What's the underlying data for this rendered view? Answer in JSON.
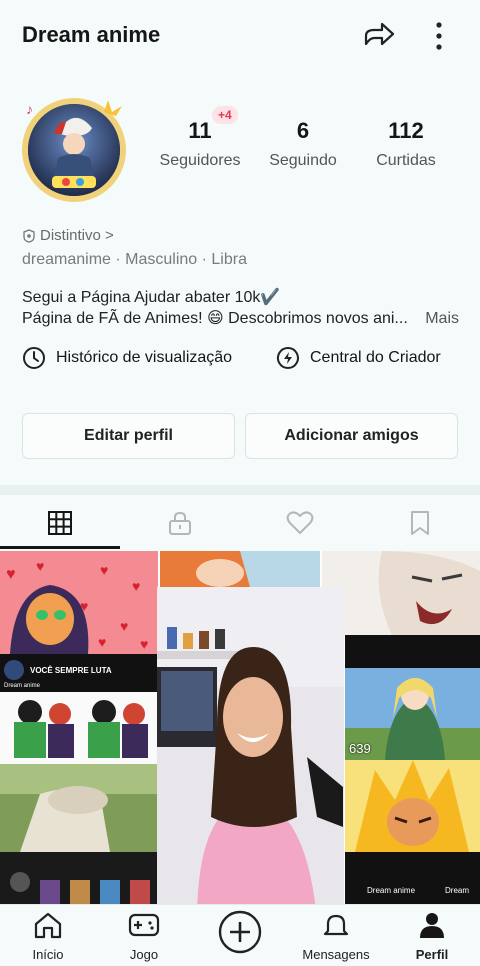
{
  "header": {
    "title": "Dream anime"
  },
  "profile": {
    "new_followers_badge": "+4",
    "stats": [
      {
        "value": "11",
        "label": "Seguidores"
      },
      {
        "value": "6",
        "label": "Seguindo"
      },
      {
        "value": "112",
        "label": "Curtidas"
      }
    ],
    "distintivo": "Distintivo >",
    "meta": "dreamanime · Masculino · Libra",
    "bio_line1": "Segui a Página Ajudar abater 10k✔️",
    "bio_line2": "Página de FÃ de Animes! 😄 Descobrimos novos ani...",
    "bio_more": "Mais"
  },
  "links": {
    "history": "Histórico de visualização",
    "creator": "Central do Criador"
  },
  "buttons": {
    "edit": "Editar perfil",
    "add_friends": "Adicionar amigos"
  },
  "tabs": [
    "grid-icon",
    "lock-icon",
    "heart-icon",
    "bookmark-icon"
  ],
  "grid": {
    "caption_luta": "VOCÊ SEMPRE LUTA",
    "channel": "Dream anime",
    "count_639": "639",
    "streamer_label": "Dream"
  },
  "nav": {
    "home": "Início",
    "game": "Jogo",
    "messages": "Mensagens",
    "profile": "Perfil"
  }
}
